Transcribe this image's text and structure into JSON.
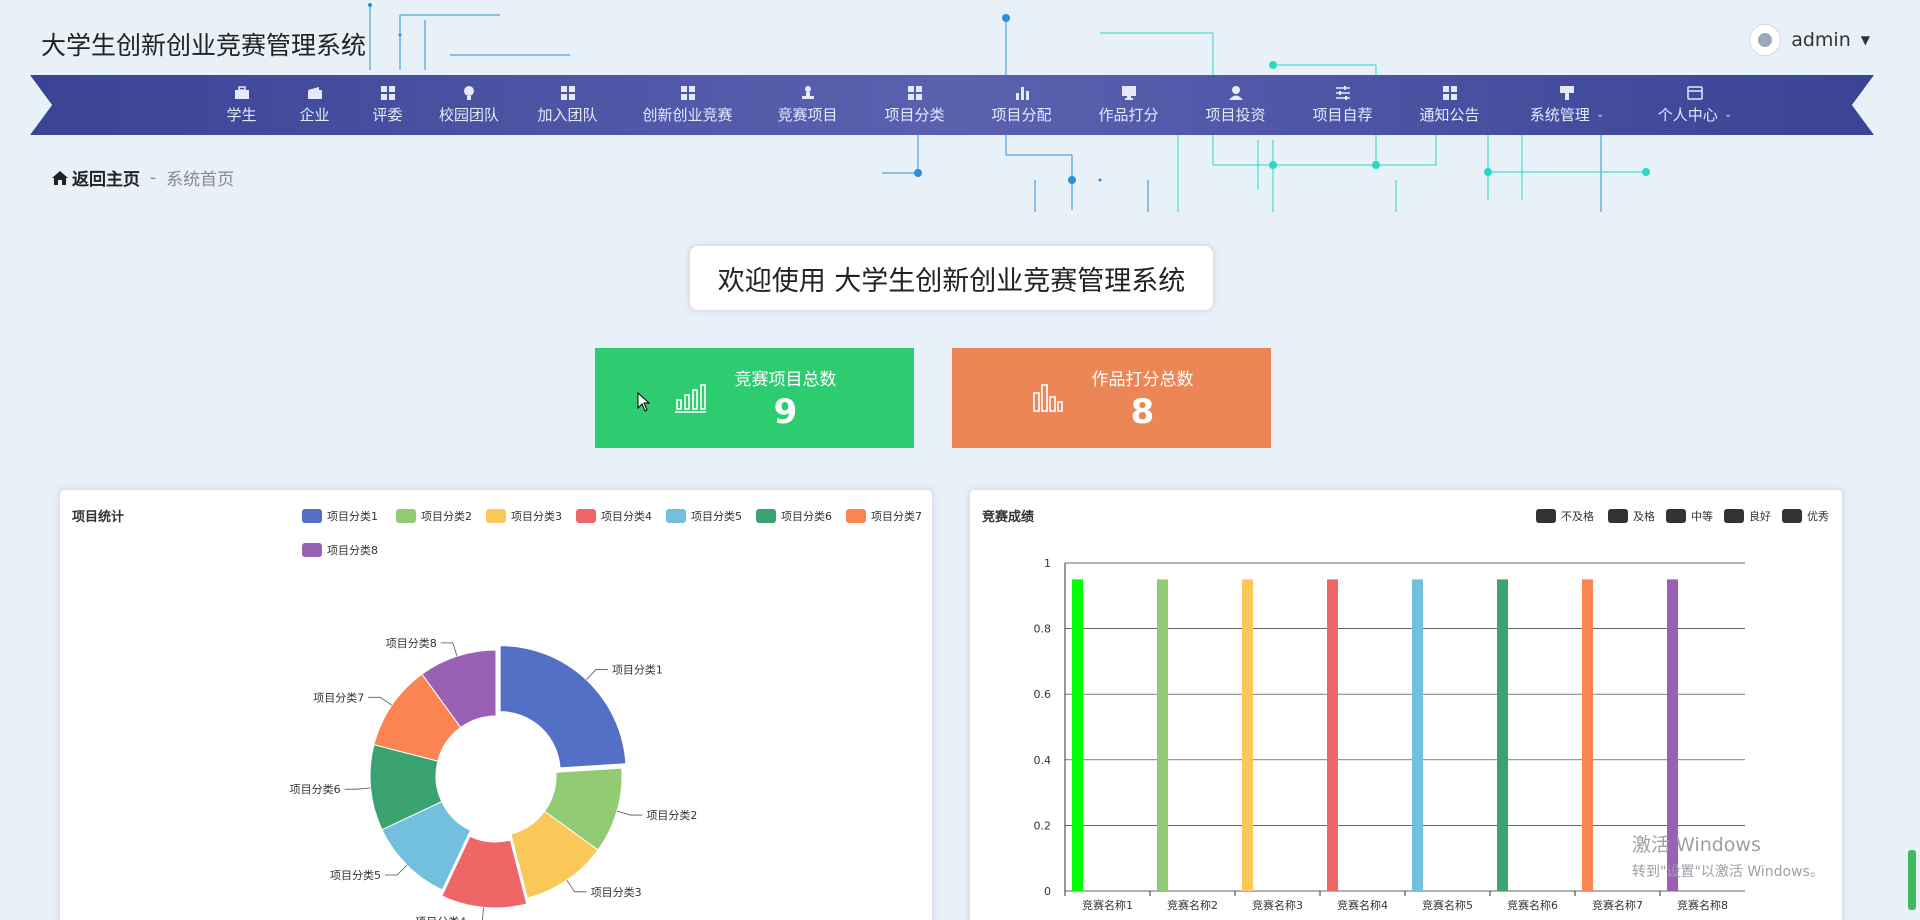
{
  "app": {
    "title": "大学生创新创业竞赛管理系统"
  },
  "user": {
    "name": "admin"
  },
  "nav": {
    "items": [
      {
        "label": "学生",
        "icon": "briefcase-icon",
        "dropdown": false
      },
      {
        "label": "企业",
        "icon": "wallet-icon",
        "dropdown": false
      },
      {
        "label": "评委",
        "icon": "grid-icon",
        "dropdown": false
      },
      {
        "label": "校园团队",
        "icon": "lightbulb-icon",
        "dropdown": false
      },
      {
        "label": "加入团队",
        "icon": "grid-icon",
        "dropdown": false
      },
      {
        "label": "创新创业竞赛",
        "icon": "grid-icon",
        "dropdown": false
      },
      {
        "label": "竞赛项目",
        "icon": "stamp-icon",
        "dropdown": false
      },
      {
        "label": "项目分类",
        "icon": "grid-icon",
        "dropdown": false
      },
      {
        "label": "项目分配",
        "icon": "bar-chart-icon",
        "dropdown": false
      },
      {
        "label": "作品打分",
        "icon": "monitor-icon",
        "dropdown": false
      },
      {
        "label": "项目投资",
        "icon": "user-icon",
        "dropdown": false
      },
      {
        "label": "项目自荐",
        "icon": "sliders-icon",
        "dropdown": false
      },
      {
        "label": "通知公告",
        "icon": "grid-icon",
        "dropdown": false
      },
      {
        "label": "系统管理",
        "icon": "brush-icon",
        "dropdown": true
      },
      {
        "label": "个人中心",
        "icon": "card-icon",
        "dropdown": true
      }
    ]
  },
  "breadcrumb": {
    "home": "返回主页",
    "separator": "-",
    "current": "系统首页"
  },
  "welcome": {
    "text": "欢迎使用 大学生创新创业竞赛管理系统"
  },
  "stats": [
    {
      "label": "竞赛项目总数",
      "value": "9",
      "color": "#2ecc71"
    },
    {
      "label": "作品打分总数",
      "value": "8",
      "color": "#ec8656"
    }
  ],
  "panels": {
    "left_title": "项目统计",
    "right_title": "竞赛成绩"
  },
  "chart_data": [
    {
      "type": "pie",
      "title": "项目统计",
      "categories": [
        "项目分类1",
        "项目分类2",
        "项目分类3",
        "项目分类4",
        "项目分类5",
        "项目分类6",
        "项目分类7",
        "项目分类8"
      ],
      "values": [
        24,
        11,
        11,
        11,
        11,
        11,
        11,
        10
      ],
      "colors": [
        "#5470c6",
        "#91cc75",
        "#fac858",
        "#ee6666",
        "#73c0de",
        "#3ba272",
        "#fc8452",
        "#9a60b4"
      ],
      "legend": "top",
      "donut": true
    },
    {
      "type": "bar",
      "title": "竞赛成绩",
      "categories": [
        "竞赛名称1",
        "竞赛名称2",
        "竞赛名称3",
        "竞赛名称4",
        "竞赛名称5",
        "竞赛名称6",
        "竞赛名称7",
        "竞赛名称8"
      ],
      "values": [
        0.95,
        0.95,
        0.95,
        0.95,
        0.95,
        0.95,
        0.95,
        0.95
      ],
      "colors": [
        "#00ff00",
        "#91cc75",
        "#fac858",
        "#ee6666",
        "#73c0de",
        "#3ba272",
        "#fc8452",
        "#9a60b4"
      ],
      "legend_items": [
        "不及格",
        "及格",
        "中等",
        "良好",
        "优秀"
      ],
      "legend_color": "#333333",
      "yticks": [
        "0",
        "0.2",
        "0.4",
        "0.6",
        "0.8",
        "1"
      ],
      "ylim": [
        0,
        1
      ],
      "grid": true,
      "legend": "top-right"
    }
  ],
  "watermark": {
    "line1": "激活 Windows",
    "line2": "转到\"设置\"以激活 Windows。"
  }
}
